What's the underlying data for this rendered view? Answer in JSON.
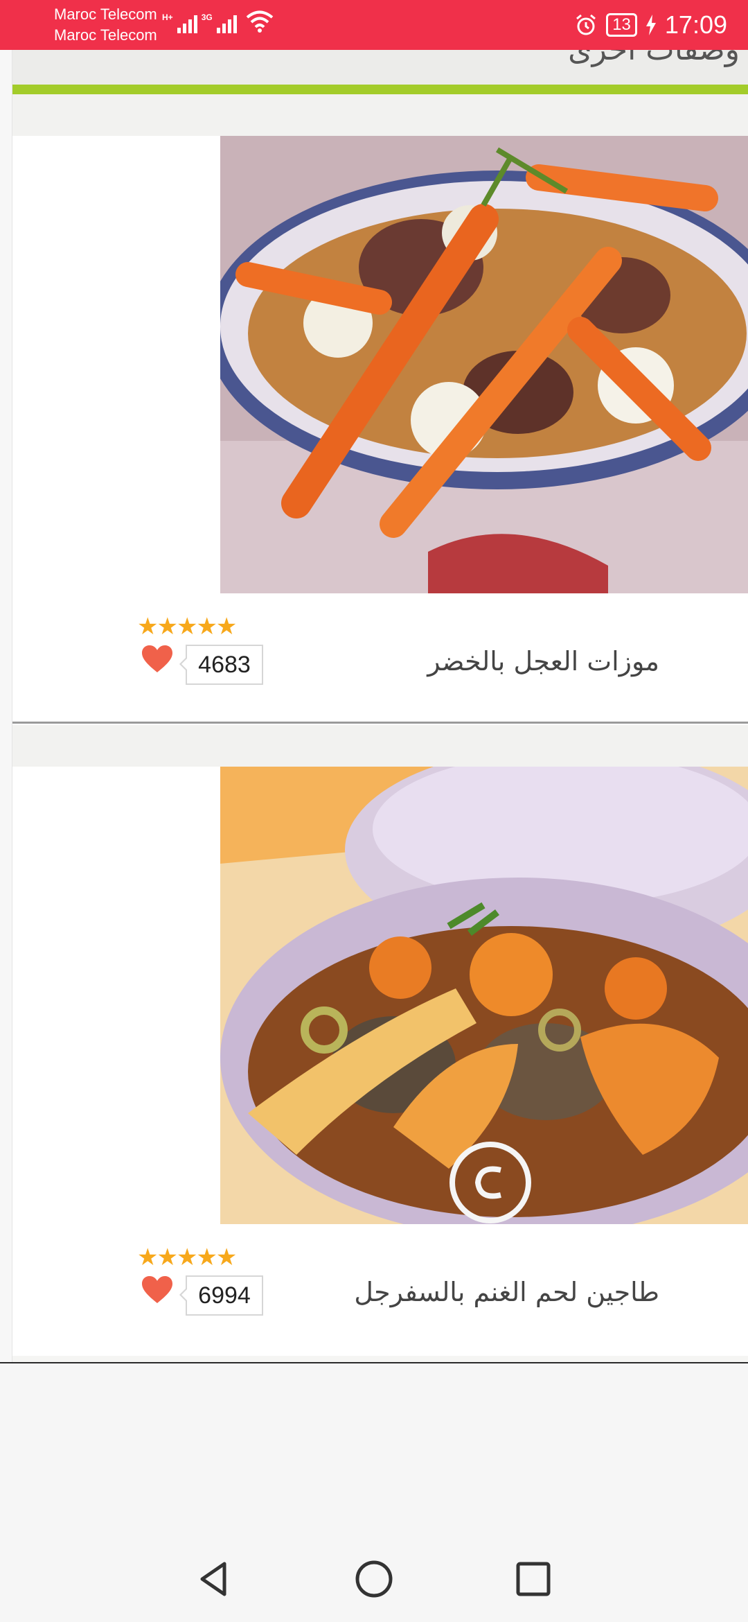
{
  "status_bar": {
    "carrier_1": "Maroc Telecom",
    "carrier_2": "Maroc Telecom",
    "net_type_1": "H+",
    "net_type_2": "3G",
    "battery": "13",
    "time": "17:09",
    "bg_color": "#f0304a"
  },
  "section": {
    "title": "وصفات أخرى"
  },
  "recipes": [
    {
      "title": "موزات العجل بالخضر",
      "likes": "4683",
      "rating": 5
    },
    {
      "title": "طاجين لحم الغنم بالسفرجل",
      "likes": "6994",
      "rating": 5
    }
  ],
  "stars_text": "★★★★★",
  "icons": {
    "heart": "heart-icon",
    "alarm": "alarm-icon",
    "wifi": "wifi-icon",
    "charging": "charging-icon",
    "back": "back-icon",
    "home": "home-icon",
    "recents": "recents-icon"
  },
  "colors": {
    "accent_green": "#a3cc2a",
    "star": "#f7a81b",
    "heart": "#f0614a"
  }
}
